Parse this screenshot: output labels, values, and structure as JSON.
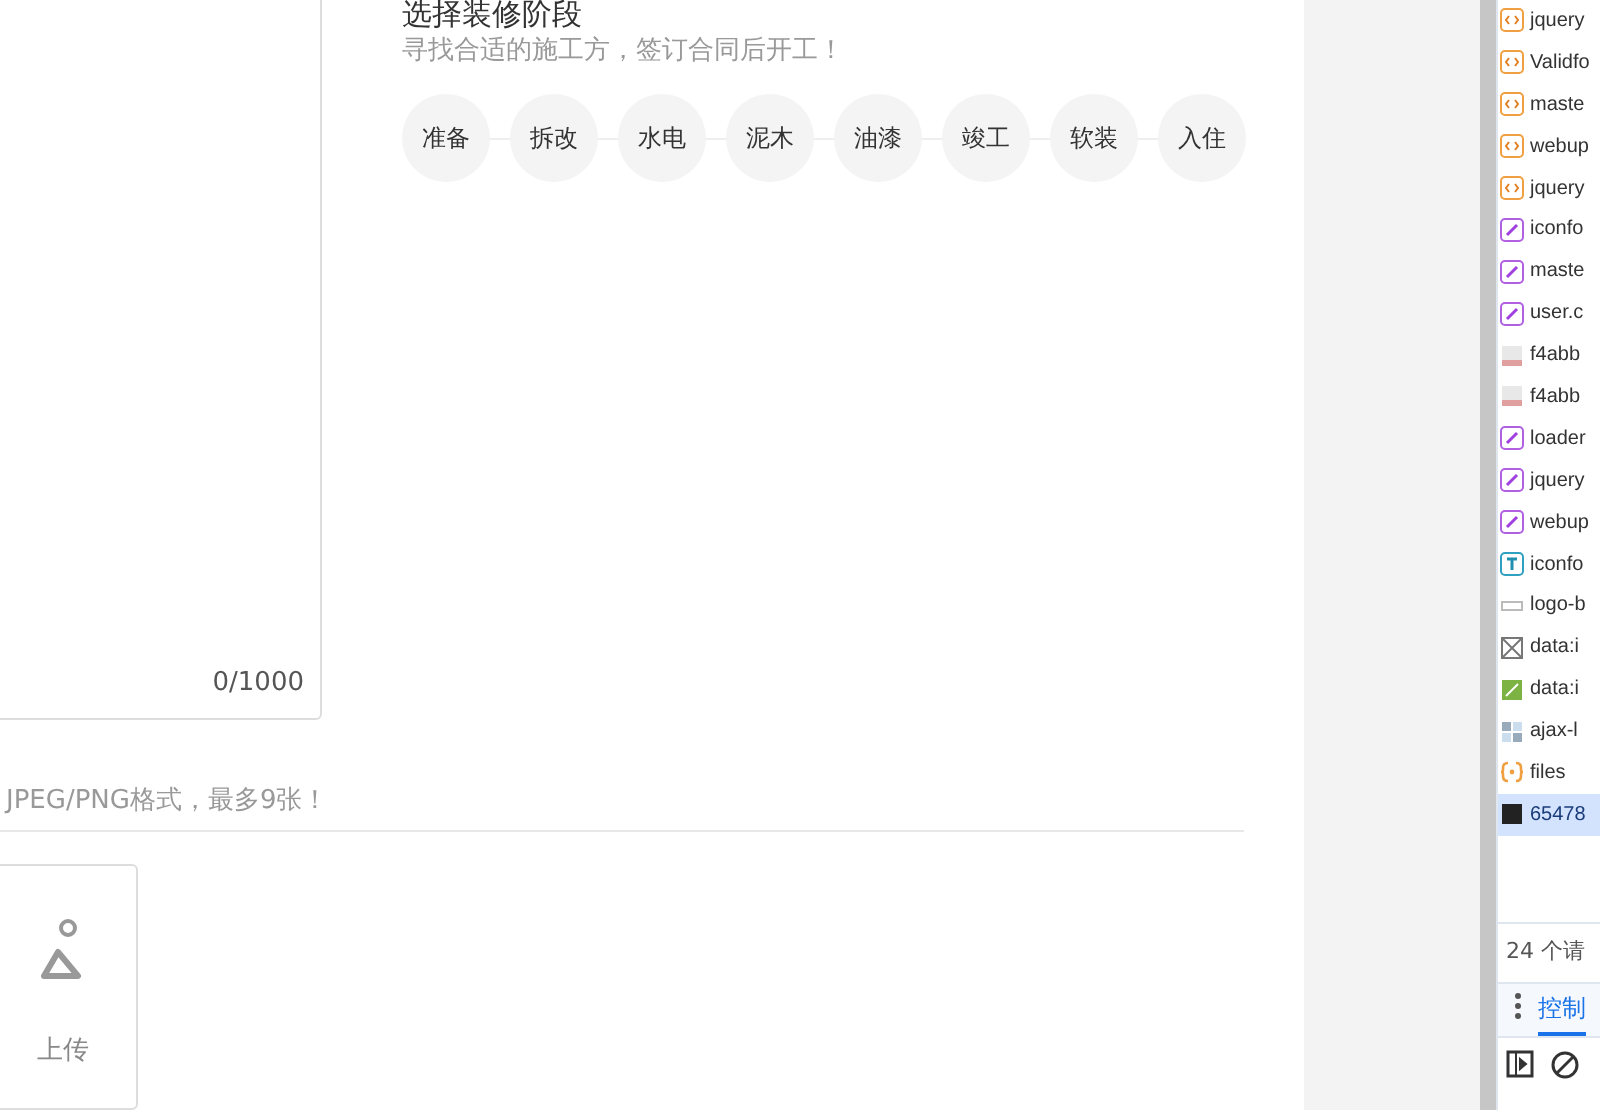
{
  "stage_section": {
    "title": "选择装修阶段",
    "subtitle": "寻找合适的施工方，签订合同后开工！",
    "stages": [
      {
        "label": "准备"
      },
      {
        "label": "拆改"
      },
      {
        "label": "水电"
      },
      {
        "label": "泥木"
      },
      {
        "label": "油漆"
      },
      {
        "label": "竣工"
      },
      {
        "label": "软装"
      },
      {
        "label": "入住"
      }
    ]
  },
  "description": {
    "counter": "0/1000"
  },
  "photos": {
    "hint": "JPEG/PNG格式，最多9张！",
    "upload_label": "上传"
  },
  "devtools": {
    "requests": [
      {
        "name": "jquery",
        "kind": "script",
        "selected": false
      },
      {
        "name": "Validfo",
        "kind": "script",
        "selected": false
      },
      {
        "name": "maste",
        "kind": "script",
        "selected": false
      },
      {
        "name": "webup",
        "kind": "script",
        "selected": false
      },
      {
        "name": "jquery",
        "kind": "script",
        "selected": false
      },
      {
        "name": "iconfo",
        "kind": "stylesheet",
        "selected": false
      },
      {
        "name": "maste",
        "kind": "stylesheet",
        "selected": false
      },
      {
        "name": "user.c",
        "kind": "stylesheet",
        "selected": false
      },
      {
        "name": "f4abb",
        "kind": "image",
        "selected": false
      },
      {
        "name": "f4abb",
        "kind": "image",
        "selected": false
      },
      {
        "name": "loader",
        "kind": "stylesheet",
        "selected": false
      },
      {
        "name": "jquery",
        "kind": "stylesheet",
        "selected": false
      },
      {
        "name": "webup",
        "kind": "stylesheet",
        "selected": false
      },
      {
        "name": "iconfo",
        "kind": "font",
        "selected": false
      },
      {
        "name": "logo-b",
        "kind": "blank",
        "selected": false
      },
      {
        "name": "data:i",
        "kind": "broken",
        "selected": false
      },
      {
        "name": "data:i",
        "kind": "photo",
        "selected": false
      },
      {
        "name": "ajax-l",
        "kind": "grid",
        "selected": false
      },
      {
        "name": "files",
        "kind": "fetch",
        "selected": false
      },
      {
        "name": "65478",
        "kind": "document",
        "selected": true
      }
    ],
    "summary": "24 个请",
    "tabs": [
      {
        "label": "控制",
        "selected": true
      }
    ]
  }
}
